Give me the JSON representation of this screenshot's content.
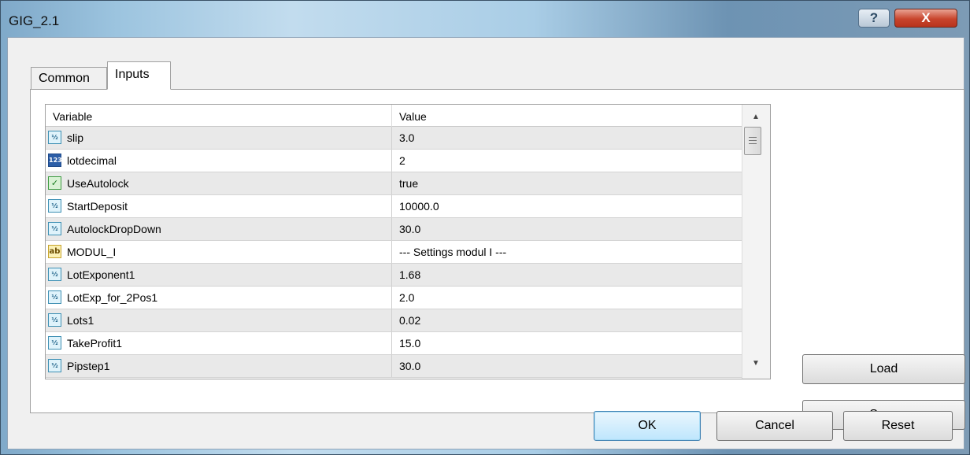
{
  "window": {
    "title": "GIG_2.1",
    "help_label": "?",
    "close_label": "X"
  },
  "tabs": [
    {
      "label": "Common"
    },
    {
      "label": "Inputs"
    }
  ],
  "grid": {
    "columns": {
      "variable": "Variable",
      "value": "Value"
    },
    "rows": [
      {
        "type_icon": "double-type-icon",
        "icon_text": "½",
        "name": "slip",
        "value": "3.0"
      },
      {
        "type_icon": "int-type-icon",
        "icon_text": "123",
        "name": "lotdecimal",
        "value": "2"
      },
      {
        "type_icon": "bool-type-icon",
        "icon_text": "✓",
        "name": "UseAutolock",
        "value": "true"
      },
      {
        "type_icon": "double-type-icon",
        "icon_text": "½",
        "name": "StartDeposit",
        "value": "10000.0"
      },
      {
        "type_icon": "double-type-icon",
        "icon_text": "½",
        "name": "AutolockDropDown",
        "value": "30.0"
      },
      {
        "type_icon": "string-type-icon",
        "icon_text": "ab",
        "name": "MODUL_I",
        "value": "--- Settings modul I ---"
      },
      {
        "type_icon": "double-type-icon",
        "icon_text": "½",
        "name": "LotExponent1",
        "value": "1.68"
      },
      {
        "type_icon": "double-type-icon",
        "icon_text": "½",
        "name": "LotExp_for_2Pos1",
        "value": "2.0"
      },
      {
        "type_icon": "double-type-icon",
        "icon_text": "½",
        "name": "Lots1",
        "value": "0.02"
      },
      {
        "type_icon": "double-type-icon",
        "icon_text": "½",
        "name": "TakeProfit1",
        "value": "15.0"
      },
      {
        "type_icon": "double-type-icon",
        "icon_text": "½",
        "name": "Pipstep1",
        "value": "30.0"
      }
    ]
  },
  "buttons": {
    "load": "Load",
    "save": "Save",
    "ok": "OK",
    "cancel": "Cancel",
    "reset": "Reset"
  }
}
